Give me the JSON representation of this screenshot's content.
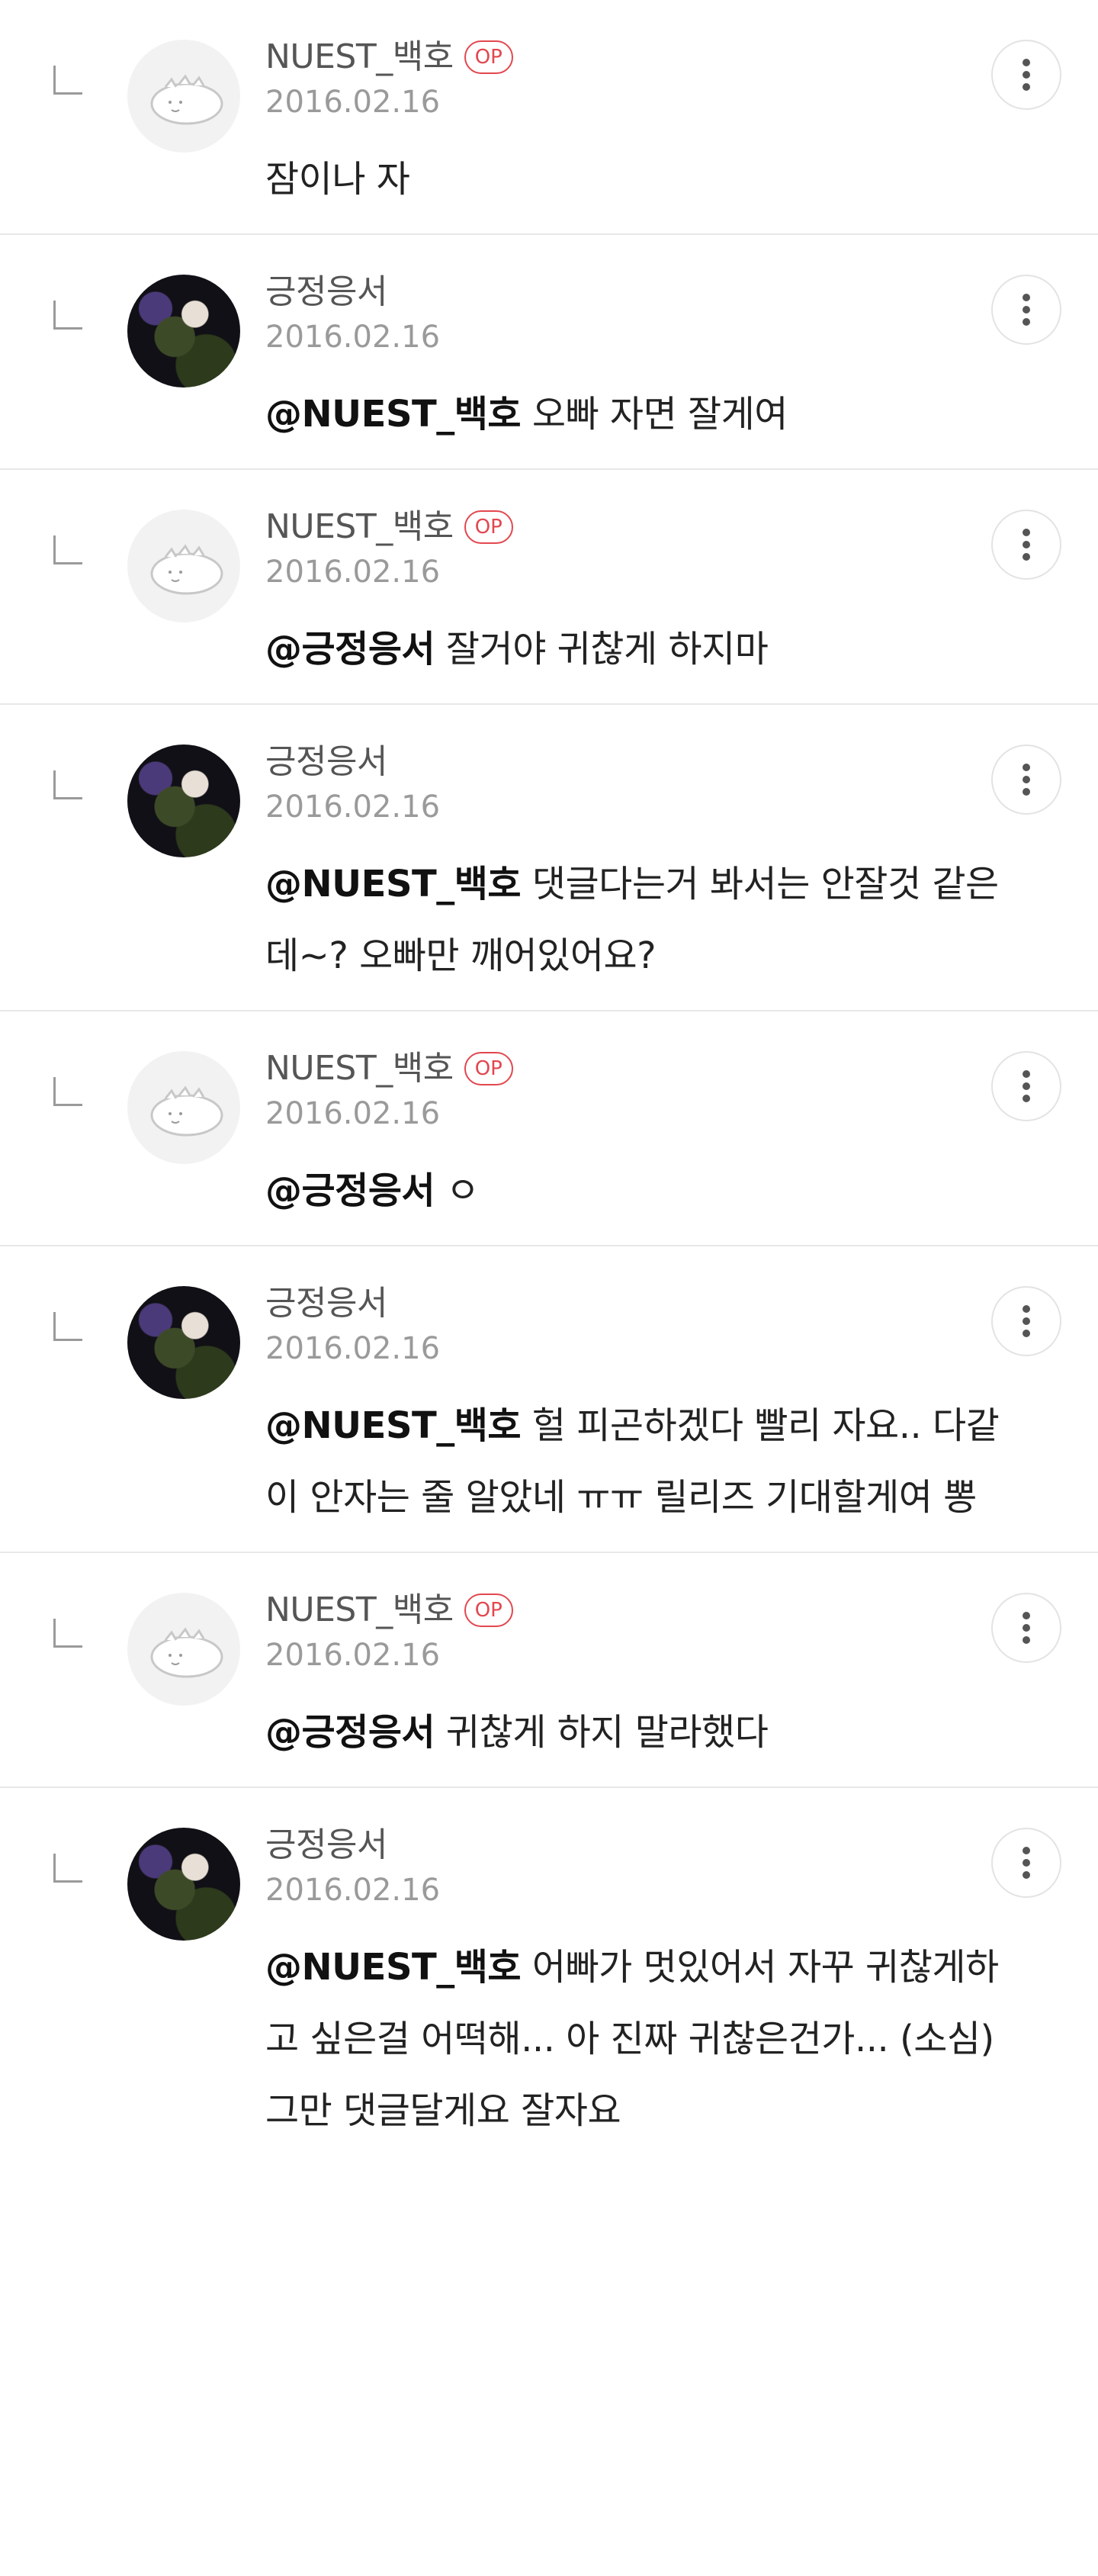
{
  "op_badge": "OP",
  "comments": [
    {
      "author": "NUEST_백호",
      "is_op": true,
      "date": "2016.02.16",
      "mention": "",
      "text": "잠이나 자"
    },
    {
      "author": "긍정응서",
      "is_op": false,
      "date": "2016.02.16",
      "mention": "@NUEST_백호",
      "text": " 오빠 자면 잘게여"
    },
    {
      "author": "NUEST_백호",
      "is_op": true,
      "date": "2016.02.16",
      "mention": "@긍정응서",
      "text": " 잘거야 귀찮게 하지마"
    },
    {
      "author": "긍정응서",
      "is_op": false,
      "date": "2016.02.16",
      "mention": "@NUEST_백호",
      "text": " 댓글다는거 봐서는 안잘것 같은데~? 오빠만 깨어있어요?"
    },
    {
      "author": "NUEST_백호",
      "is_op": true,
      "date": "2016.02.16",
      "mention": "@긍정응서",
      "text": " ㅇ"
    },
    {
      "author": "긍정응서",
      "is_op": false,
      "date": "2016.02.16",
      "mention": "@NUEST_백호",
      "text": " 헐 피곤하겠다 빨리 자요.. 다같이 안자는 줄 알았네 ㅠㅠ 릴리즈 기대할게여 뽕"
    },
    {
      "author": "NUEST_백호",
      "is_op": true,
      "date": "2016.02.16",
      "mention": "@긍정응서",
      "text": " 귀찮게 하지 말라했다"
    },
    {
      "author": "긍정응서",
      "is_op": false,
      "date": "2016.02.16",
      "mention": "@NUEST_백호",
      "text": " 어빠가 멋있어서 자꾸 귀찮게하고 싶은걸 어떡해... 아 진짜 귀찮은건가... (소심) 그만 댓글달게요 잘자요"
    }
  ]
}
